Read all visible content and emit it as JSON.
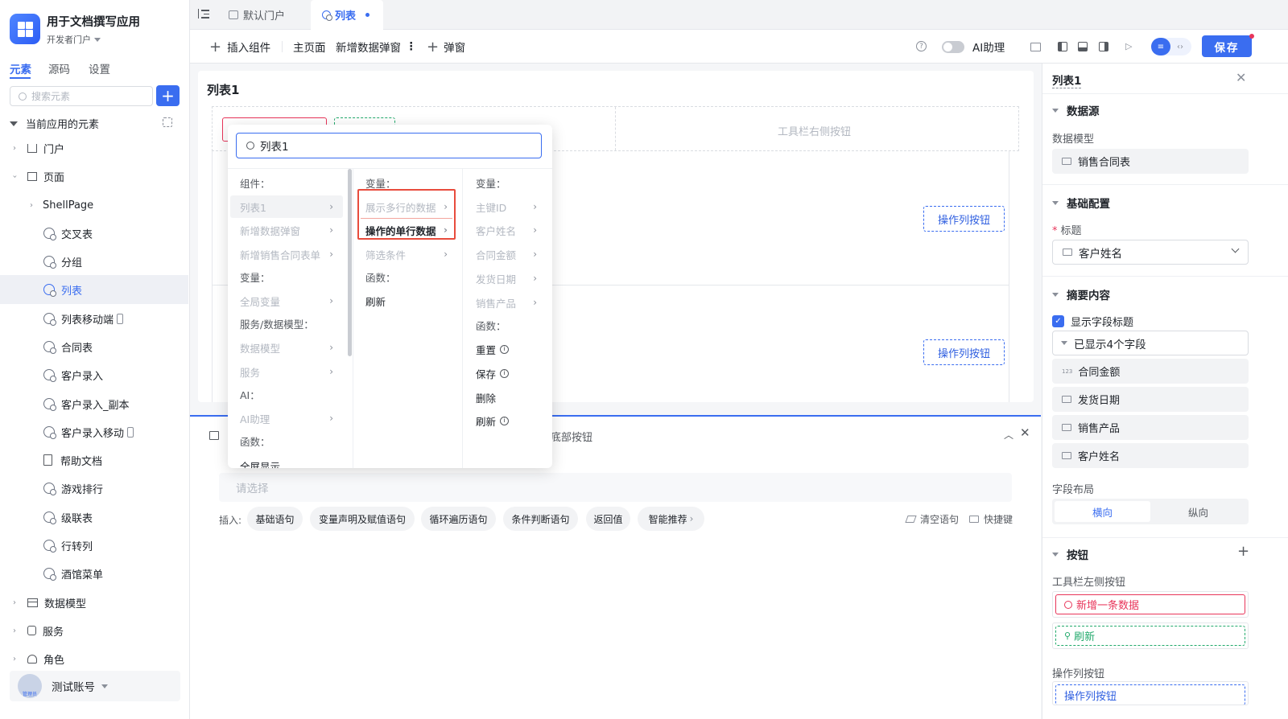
{
  "app": {
    "name": "用于文档撰写应用",
    "portal": "开发者门户"
  },
  "left": {
    "tabs": [
      "元素",
      "源码",
      "设置"
    ],
    "search_placeholder": "搜索元素",
    "section_title": "当前应用的元素",
    "items": [
      "门户",
      "页面",
      "ShellPage",
      "交叉表",
      "分组",
      "列表",
      "列表移动端",
      "合同表",
      "客户录入",
      "客户录入_副本",
      "客户录入移动",
      "帮助文档",
      "游戏排行",
      "级联表",
      "行转列",
      "酒馆菜单",
      "数据模型",
      "服务",
      "角色"
    ],
    "account": "测试账号",
    "avatar_text": "管理员"
  },
  "tabs": [
    {
      "label": "默认门户"
    },
    {
      "label": "列表"
    }
  ],
  "toolbar": {
    "insert": "插入组件",
    "main_page": "主页面",
    "new_dialog": "新增数据弹窗",
    "popup": "弹窗",
    "ai": "AI助理",
    "save": "保存"
  },
  "canvas": {
    "title": "列表1",
    "toolbar_right": "工具栏右侧按钮",
    "op_btn1": "操作列按钮",
    "op_btn2": "操作列按钮"
  },
  "dropdown": {
    "search_value": "列表1",
    "col1": {
      "h_component": "组件：",
      "list1": "列表1",
      "new_dialog": "新增数据弹窗",
      "new_contract_form": "新增销售合同表单",
      "h_var": "变量：",
      "global_var": "全局变量",
      "h_service": "服务/数据模型：",
      "data_model": "数据模型",
      "service": "服务",
      "h_ai": "AI：",
      "ai_assistant": "AI助理",
      "h_func": "函数：",
      "fullscreen": "全屏显示"
    },
    "col2": {
      "h_var": "变量：",
      "multi_row": "展示多行的数据",
      "single_row": "操作的单行数据",
      "filter": "筛选条件",
      "h_func": "函数：",
      "refresh": "刷新"
    },
    "col3": {
      "h_var": "变量：",
      "pk": "主键ID",
      "customer": "客户姓名",
      "amount": "合同金额",
      "ship_date": "发货日期",
      "product": "销售产品",
      "h_func": "函数：",
      "reset": "重置",
      "save": "保存",
      "delete": "删除",
      "refresh": "刷新"
    }
  },
  "bottom": {
    "partial_label": "底部按钮",
    "placeholder": "请选择",
    "insert_label": "插入:",
    "pills": [
      "基础语句",
      "变量声明及赋值语句",
      "循环遍历语句",
      "条件判断语句",
      "返回值",
      "智能推荐"
    ],
    "clear": "清空语句",
    "shortcut": "快捷键"
  },
  "right": {
    "title": "列表1",
    "s_datasource": "数据源",
    "l_model": "数据模型",
    "v_model": "销售合同表",
    "s_basic": "基础配置",
    "l_title": "标题",
    "v_title": "客户姓名",
    "s_summary": "摘要内容",
    "show_field_title": "显示字段标题",
    "shown": "已显示4个字段",
    "fields": [
      {
        "label": "合同金额",
        "icon": "number-icon"
      },
      {
        "label": "发货日期",
        "icon": "calendar-icon"
      },
      {
        "label": "销售产品",
        "icon": "text-icon"
      },
      {
        "label": "客户姓名",
        "icon": "text-icon"
      }
    ],
    "l_layout": "字段布局",
    "layout": [
      "横向",
      "纵向"
    ],
    "s_buttons": "按钮",
    "l_toolbar_left": "工具栏左侧按钮",
    "btn_add": "新增一条数据",
    "btn_refresh": "刷新",
    "l_op": "操作列按钮",
    "btn_op": "操作列按钮"
  },
  "colors": {
    "accent": "#3a6df0",
    "danger": "#e8355a",
    "success": "#21a96b"
  }
}
